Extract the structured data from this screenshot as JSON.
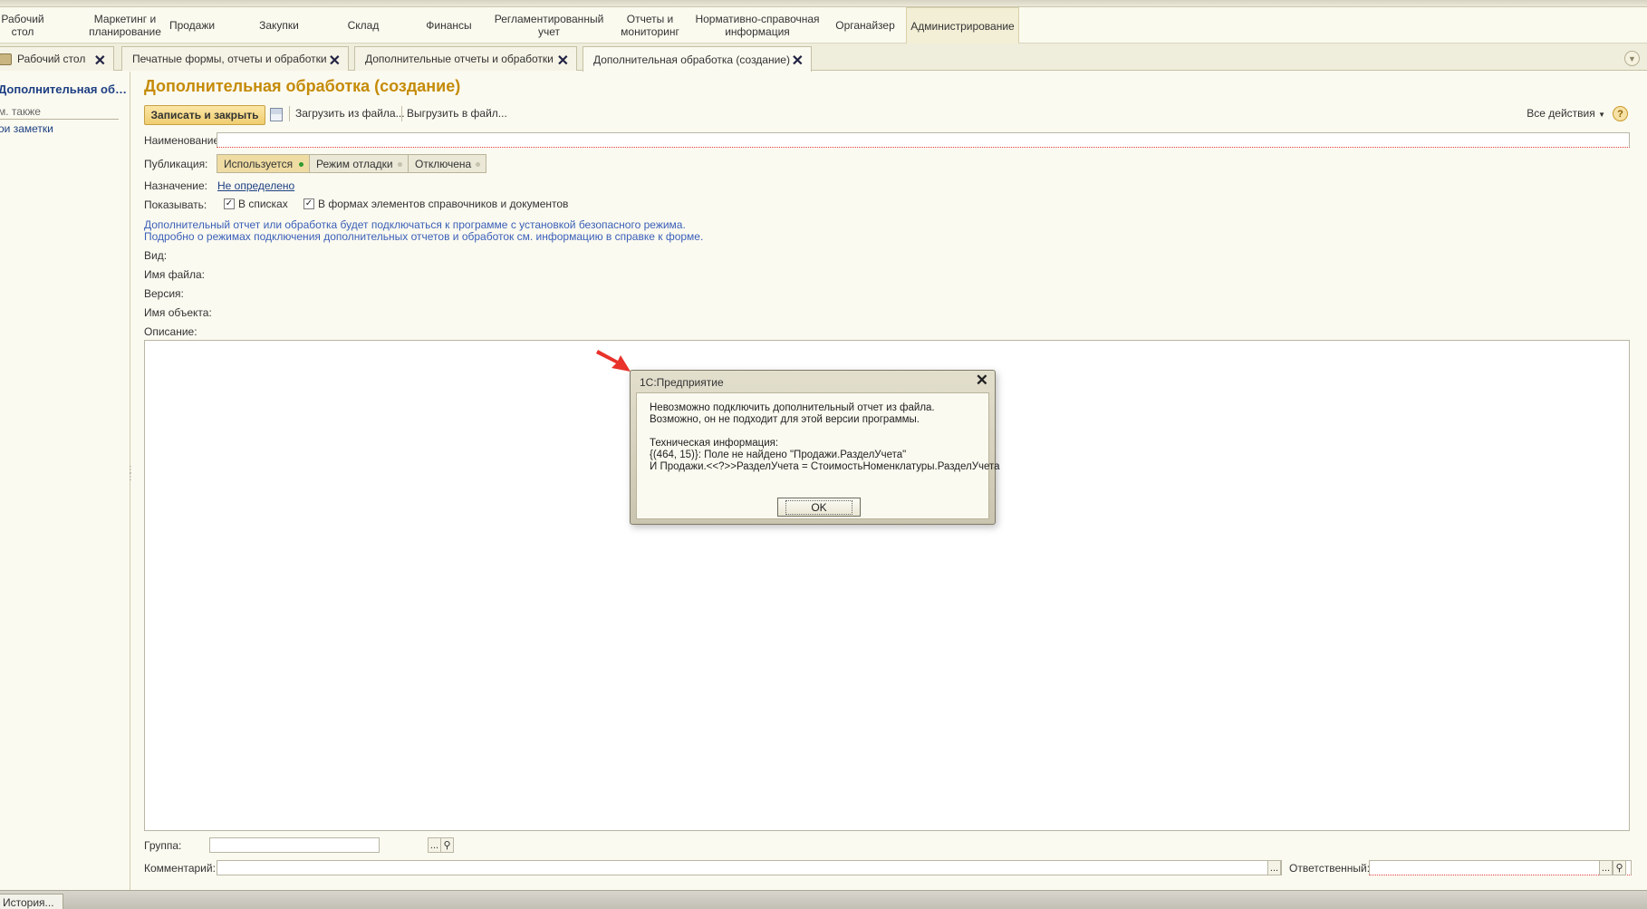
{
  "menubar": {
    "items": [
      {
        "label": "Рабочий\nстол"
      },
      {
        "label": "Маркетинг и\nпланирование"
      },
      {
        "label": "Продажи"
      },
      {
        "label": "Закупки"
      },
      {
        "label": "Склад"
      },
      {
        "label": "Финансы"
      },
      {
        "label": "Регламентированный\nучет"
      },
      {
        "label": "Отчеты и\nмониторинг"
      },
      {
        "label": "Нормативно-справочная\nинформация"
      },
      {
        "label": "Органайзер"
      },
      {
        "label": "Администрирование"
      }
    ]
  },
  "tabs": [
    {
      "label": "Рабочий стол"
    },
    {
      "label": "Печатные формы, отчеты и обработки"
    },
    {
      "label": "Дополнительные отчеты и обработки"
    },
    {
      "label": "Дополнительная обработка (создание)"
    }
  ],
  "left_panel": {
    "title": "Дополнительная обр...",
    "see_also": "м. также",
    "link": "ои заметки"
  },
  "form": {
    "title": "Дополнительная обработка (создание)",
    "save_close": "Записать и закрыть",
    "load_from_file": "Загрузить из файла...",
    "export_to_file": "Выгрузить в файл...",
    "all_actions": "Все действия",
    "help": "?",
    "name_label": "Наименование:",
    "name_value": "",
    "publication_label": "Публикация:",
    "publication_options": [
      "Используется",
      "Режим отладки",
      "Отключена"
    ],
    "assignment_label": "Назначение:",
    "assignment_value": "Не определено",
    "show_label": "Показывать:",
    "show_in_lists": "В списках",
    "show_in_forms": "В формах элементов справочников и документов",
    "info_line1": "Дополнительный отчет или обработка будет подключаться к программе с установкой безопасного режима.",
    "info_line2": "Подробно о режимах подключения дополнительных отчетов и обработок см. информацию в справке к форме.",
    "kind_label": "Вид:",
    "filename_label": "Имя файла:",
    "version_label": "Версия:",
    "object_name_label": "Имя объекта:",
    "description_label": "Описание:",
    "group_label": "Группа:",
    "comment_label": "Комментарий:",
    "responsible_label": "Ответственный:",
    "ellipsis": "...",
    "search_glyph": "⚲"
  },
  "dialog": {
    "title": "1С:Предприятие",
    "line1": "Невозможно подключить дополнительный отчет из файла.",
    "line2": "Возможно, он не подходит для этой версии программы.",
    "tech_label": "Техническая информация:",
    "tech_line1": "{(464, 15)}: Поле не найдено \"Продажи.РазделУчета\"",
    "tech_line2": "И Продажи.<<?>>РазделУчета = СтоимостьНоменклатуры.РазделУчета",
    "ok": "OK"
  },
  "taskbar": {
    "history": "История..."
  },
  "colors": {
    "title": "#c58b08",
    "link": "#1d3f83",
    "info": "#3a5fb8",
    "arrow": "#e8322a"
  }
}
